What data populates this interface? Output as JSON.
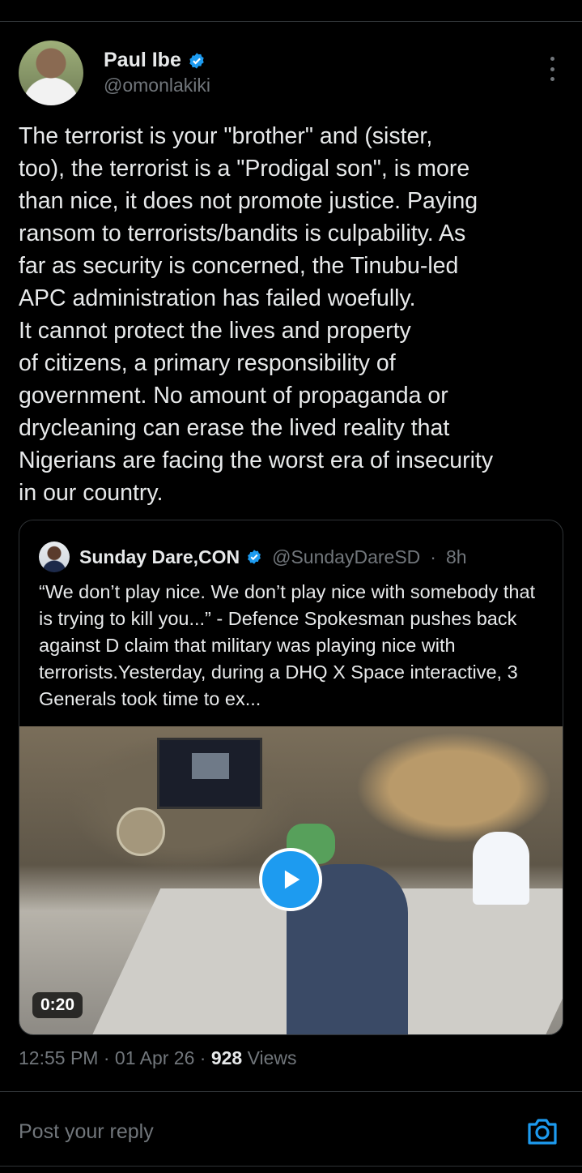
{
  "author": {
    "name": "Paul Ibe",
    "handle": "@omonlakiki",
    "verified_icon": "verified-badge-icon",
    "more_icon": "more-options-icon"
  },
  "tweet": {
    "text": "The terrorist is your \"brother\" and (sister,\ntoo), the terrorist is a \"Prodigal son\", is more\nthan nice, it does not promote justice. Paying\nransom to terrorists/bandits is culpability. As\nfar as security is concerned, the Tinubu-led\nAPC administration has failed woefully.\nIt cannot protect the lives and property\nof citizens, a primary responsibility of\ngovernment. No amount of propaganda or\ndrycleaning can erase the lived reality that\nNigerians are facing the worst era of insecurity\nin our country."
  },
  "quote": {
    "name": "Sunday Dare,CON",
    "handle": "@SundayDareSD",
    "separator": "·",
    "time": "8h",
    "text": "“We don’t play nice. We don’t play nice with somebody that is trying to kill you...” - Defence Spokesman  pushes back against D claim that military was playing nice with terrorists.Yesterday, during a DHQ X Space interactive, 3 Generals took time to ex...",
    "video_duration": "0:20",
    "play_icon": "play-icon"
  },
  "meta": {
    "time": "12:55 PM",
    "dot1": "·",
    "date": "01 Apr 26",
    "dot2": "·",
    "views_count": "928",
    "views_label": "Views"
  },
  "reply": {
    "placeholder": "Post your reply",
    "camera_icon": "camera-icon"
  },
  "colors": {
    "background": "#000000",
    "text": "#e7e9ea",
    "secondary": "#71767b",
    "accent": "#1d9bf0",
    "border": "#2f3336"
  }
}
